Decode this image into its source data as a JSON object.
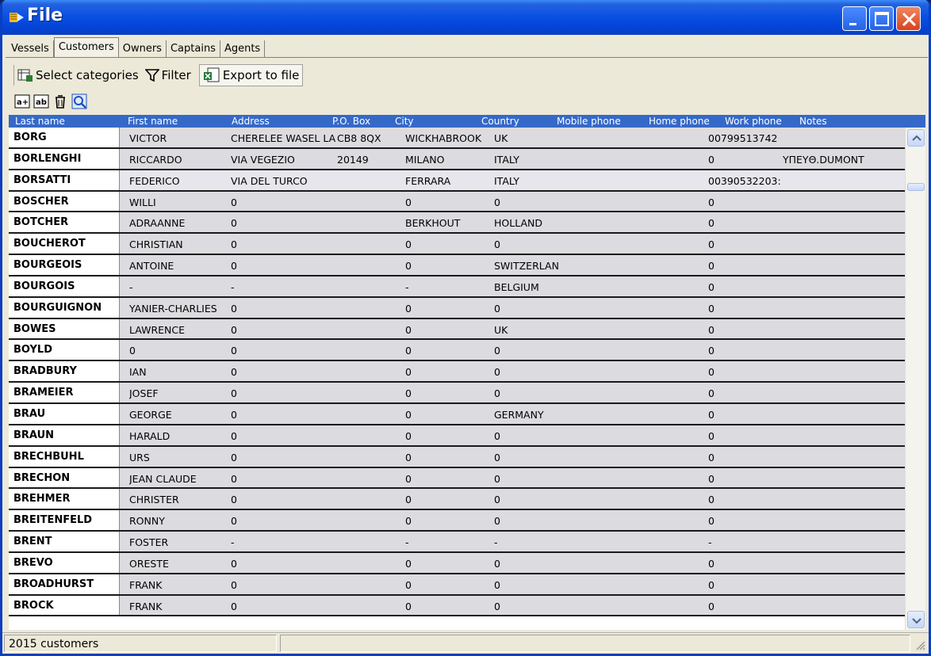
{
  "window": {
    "title": "File"
  },
  "tabs": [
    {
      "label": "Vessels",
      "active": false
    },
    {
      "label": "Customers",
      "active": true
    },
    {
      "label": "Owners",
      "active": false
    },
    {
      "label": "Captains",
      "active": false
    },
    {
      "label": "Agents",
      "active": false
    }
  ],
  "toolbar": {
    "select_categories": "Select categories",
    "filter": "Filter",
    "export": "Export to file"
  },
  "columns": [
    "Last name",
    "First name",
    "Address",
    "P.O. Box",
    "City",
    "Country",
    "Mobile phone",
    "Home phone",
    "Work phone",
    "Notes"
  ],
  "rows": [
    {
      "last": "BORG",
      "first": "VICTOR",
      "address": "CHERELEE WASEL LA",
      "pobox": "CB8 8QX",
      "city": "WICKHABROOK",
      "country": "UK",
      "work": "00799513742",
      "notes": ""
    },
    {
      "last": "BORLENGHI",
      "first": "RICCARDO",
      "address": "VIA VEGEZIO",
      "pobox": "20149",
      "city": "MILANO",
      "country": "ITALY",
      "work": "0",
      "notes": "ΥΠΕΥΘ.DUMONT"
    },
    {
      "last": "BORSATTI",
      "first": "FEDERICO",
      "address": "VIA DEL TURCO",
      "pobox": "",
      "city": "FERRARA",
      "country": "ITALY",
      "work": "00390532203:",
      "notes": "",
      "selected": true
    },
    {
      "last": "BOSCHER",
      "first": "WILLI",
      "address": "0",
      "pobox": "",
      "city": "0",
      "country": "0",
      "work": "0",
      "notes": ""
    },
    {
      "last": "BOTCHER",
      "first": "ADRAANNE",
      "address": "0",
      "pobox": "",
      "city": "BERKHOUT",
      "country": "HOLLAND",
      "work": "0",
      "notes": ""
    },
    {
      "last": "BOUCHEROT",
      "first": "CHRISTIAN",
      "address": "0",
      "pobox": "",
      "city": "0",
      "country": "0",
      "work": "0",
      "notes": ""
    },
    {
      "last": "BOURGEOIS",
      "first": "ANTOINE",
      "address": "0",
      "pobox": "",
      "city": "0",
      "country": "SWITZERLAN",
      "work": "0",
      "notes": ""
    },
    {
      "last": "BOURGOIS",
      "first": "-",
      "address": "-",
      "pobox": "",
      "city": "-",
      "country": "BELGIUM",
      "work": "0",
      "notes": ""
    },
    {
      "last": "BOURGUIGNON",
      "first": "YANIER-CHARLIES",
      "address": "0",
      "pobox": "",
      "city": "0",
      "country": "0",
      "work": "0",
      "notes": ""
    },
    {
      "last": "BOWES",
      "first": "LAWRENCE",
      "address": "0",
      "pobox": "",
      "city": "0",
      "country": "UK",
      "work": "0",
      "notes": ""
    },
    {
      "last": "BOYLD",
      "first": "0",
      "address": "0",
      "pobox": "",
      "city": "0",
      "country": "0",
      "work": "0",
      "notes": ""
    },
    {
      "last": "BRADBURY",
      "first": "IAN",
      "address": "0",
      "pobox": "",
      "city": "0",
      "country": "0",
      "work": "0",
      "notes": ""
    },
    {
      "last": "BRAMEIER",
      "first": "JOSEF",
      "address": "0",
      "pobox": "",
      "city": "0",
      "country": "0",
      "work": "0",
      "notes": ""
    },
    {
      "last": "BRAU",
      "first": "GEORGE",
      "address": "0",
      "pobox": "",
      "city": "0",
      "country": "GERMANY",
      "work": "0",
      "notes": ""
    },
    {
      "last": "BRAUN",
      "first": "HARALD",
      "address": "0",
      "pobox": "",
      "city": "0",
      "country": "0",
      "work": "0",
      "notes": ""
    },
    {
      "last": "BRECHBUHL",
      "first": "URS",
      "address": "0",
      "pobox": "",
      "city": "0",
      "country": "0",
      "work": "0",
      "notes": ""
    },
    {
      "last": "BRECHON",
      "first": "JEAN CLAUDE",
      "address": "0",
      "pobox": "",
      "city": "0",
      "country": "0",
      "work": "0",
      "notes": ""
    },
    {
      "last": "BREHMER",
      "first": "CHRISTER",
      "address": "0",
      "pobox": "",
      "city": "0",
      "country": "0",
      "work": "0",
      "notes": ""
    },
    {
      "last": "BREITENFELD",
      "first": "RONNY",
      "address": "0",
      "pobox": "",
      "city": "0",
      "country": "0",
      "work": "0",
      "notes": ""
    },
    {
      "last": "BRENT",
      "first": "FOSTER",
      "address": "-",
      "pobox": "",
      "city": "-",
      "country": "-",
      "work": "-",
      "notes": ""
    },
    {
      "last": "BREVO",
      "first": "ORESTE",
      "address": "0",
      "pobox": "",
      "city": "0",
      "country": "0",
      "work": "0",
      "notes": ""
    },
    {
      "last": "BROADHURST",
      "first": "FRANK",
      "address": "0",
      "pobox": "",
      "city": "0",
      "country": "0",
      "work": "0",
      "notes": ""
    },
    {
      "last": "BROCK",
      "first": "FRANK",
      "address": "0",
      "pobox": "",
      "city": "0",
      "country": "0",
      "work": "0",
      "notes": ""
    }
  ],
  "status": {
    "count_text": "2015 customers"
  }
}
